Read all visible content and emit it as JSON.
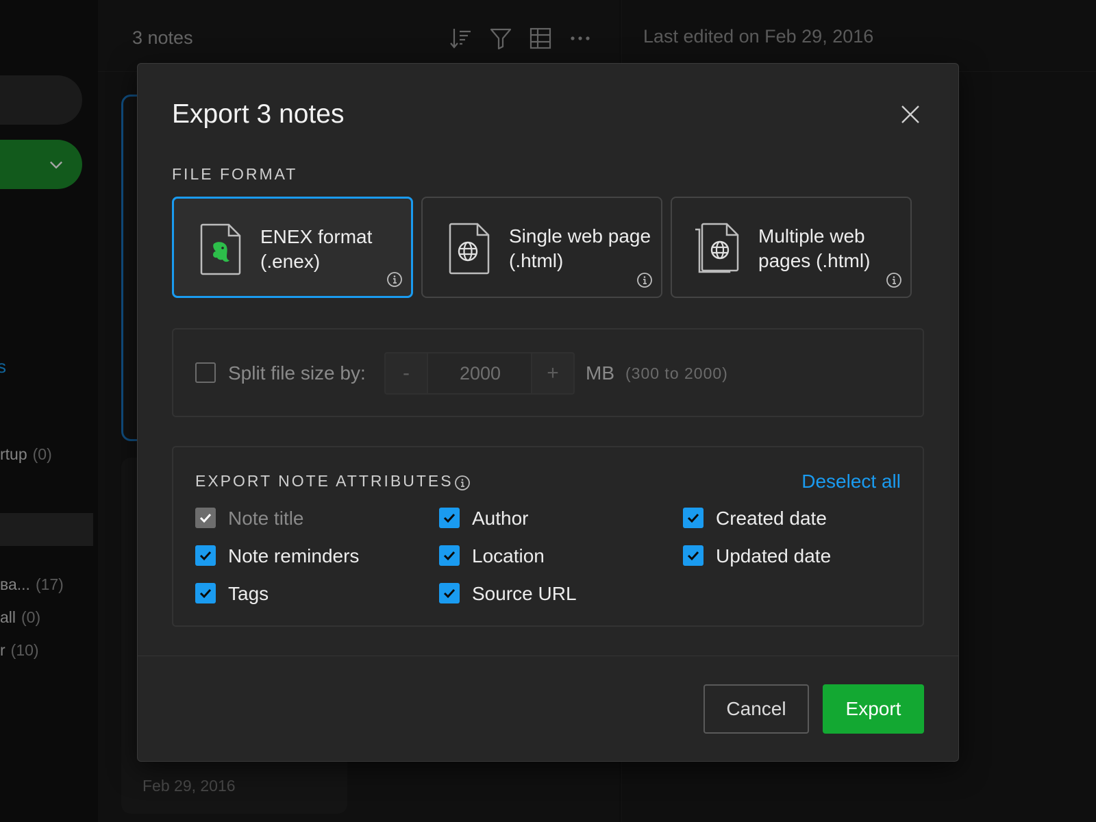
{
  "background": {
    "sidebar": {
      "link_fragment": "s",
      "rows": [
        {
          "label": "rtup",
          "count": "(0)"
        },
        {
          "label": "ва...",
          "count": "(17)"
        },
        {
          "label": "all",
          "count": "(0)"
        },
        {
          "label": "r",
          "count": "(10)"
        }
      ]
    },
    "notelist": {
      "count_label": "3 notes",
      "card_date": "Feb 29, 2016"
    },
    "editor": {
      "last_edited": "Last edited on Feb 29, 2016"
    }
  },
  "modal": {
    "title": "Export 3 notes",
    "file_format_label": "FILE FORMAT",
    "formats": [
      {
        "label": "ENEX format (.enex)",
        "icon": "evernote-file-icon",
        "selected": true
      },
      {
        "label": "Single web page (.html)",
        "icon": "globe-file-icon",
        "selected": false
      },
      {
        "label": "Multiple web pages (.html)",
        "icon": "globe-files-icon",
        "selected": false
      }
    ],
    "split": {
      "label": "Split file size by:",
      "minus": "-",
      "value": "2000",
      "plus": "+",
      "unit": "MB",
      "range": "(300 to 2000)",
      "checked": false
    },
    "attributes": {
      "label": "EXPORT NOTE ATTRIBUTES",
      "deselect_label": "Deselect all",
      "items": [
        {
          "label": "Note title",
          "checked": true,
          "disabled": true
        },
        {
          "label": "Author",
          "checked": true,
          "disabled": false
        },
        {
          "label": "Created date",
          "checked": true,
          "disabled": false
        },
        {
          "label": "Note reminders",
          "checked": true,
          "disabled": false
        },
        {
          "label": "Location",
          "checked": true,
          "disabled": false
        },
        {
          "label": "Updated date",
          "checked": true,
          "disabled": false
        },
        {
          "label": "Tags",
          "checked": true,
          "disabled": false
        },
        {
          "label": "Source URL",
          "checked": true,
          "disabled": false
        }
      ]
    },
    "buttons": {
      "cancel": "Cancel",
      "export": "Export"
    },
    "colors": {
      "accent": "#1a9bf0",
      "export_green": "#13a832",
      "modal_bg": "#262626"
    }
  }
}
